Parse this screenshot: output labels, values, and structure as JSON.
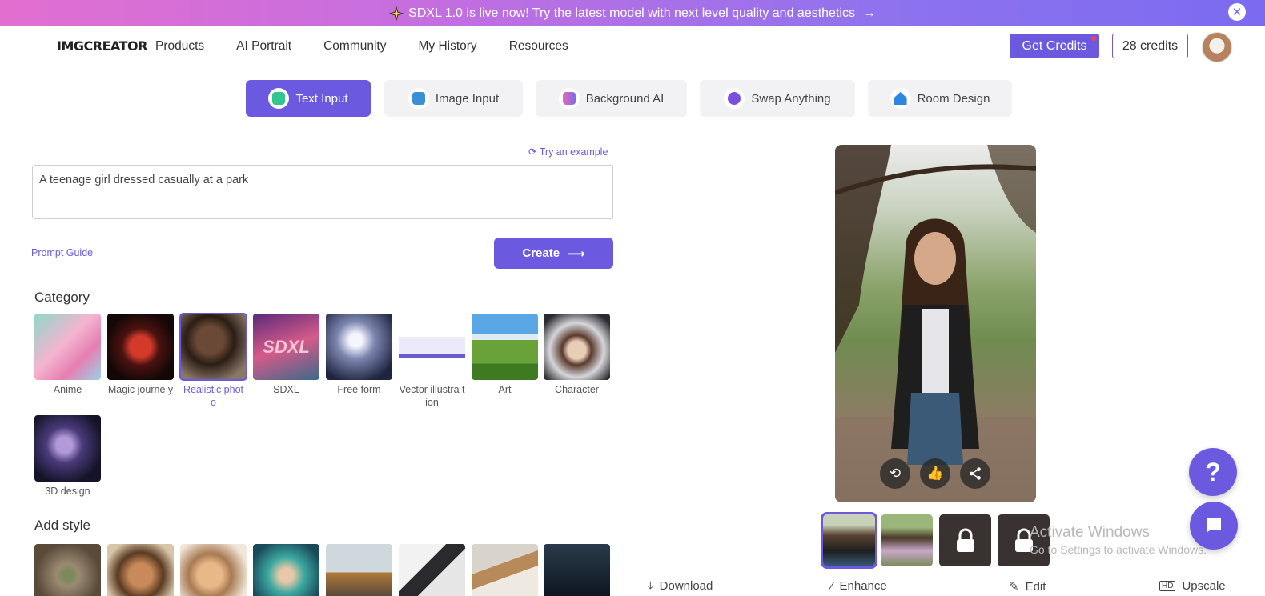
{
  "banner": {
    "text": "SDXL 1.0 is live now! Try the latest model with next level quality and aesthetics",
    "arrow": "→",
    "close": "✕"
  },
  "header": {
    "logo": "IMGCREATOR",
    "nav": [
      "Products",
      "AI Portrait",
      "Community",
      "My History",
      "Resources"
    ],
    "get_credits": "Get Credits",
    "credits": "28 credits"
  },
  "tabs": [
    {
      "label": "Text Input",
      "icon": "text-input-icon",
      "active": true
    },
    {
      "label": "Image Input",
      "icon": "image-input-icon"
    },
    {
      "label": "Background AI",
      "icon": "background-ai-icon"
    },
    {
      "label": "Swap Anything",
      "icon": "swap-anything-icon"
    },
    {
      "label": "Room Design",
      "icon": "room-design-icon"
    }
  ],
  "prompt": {
    "try_example": "Try an example",
    "value": "A teenage girl dressed casually at a park",
    "guide": "Prompt Guide",
    "create": "Create"
  },
  "category": {
    "title": "Category",
    "items": [
      "Anime",
      "Magic journe y",
      "Realistic phot o",
      "SDXL",
      "Free form",
      "Vector illustra tion",
      "Art",
      "Character",
      "3D design"
    ],
    "selected": "Realistic phot o"
  },
  "add_style": {
    "title": "Add style"
  },
  "result": {
    "actions": [
      "Download",
      "Enhance",
      "Edit",
      "Upscale"
    ],
    "sdxl_thumb_text": "SDXL"
  },
  "watermark": {
    "line1": "Activate Windows",
    "line2": "Go to Settings to activate Windows."
  },
  "help": "?",
  "colors": {
    "accent": "#6b5ae0",
    "banner_start": "#e26fd0",
    "banner_end": "#7b6bf0"
  }
}
